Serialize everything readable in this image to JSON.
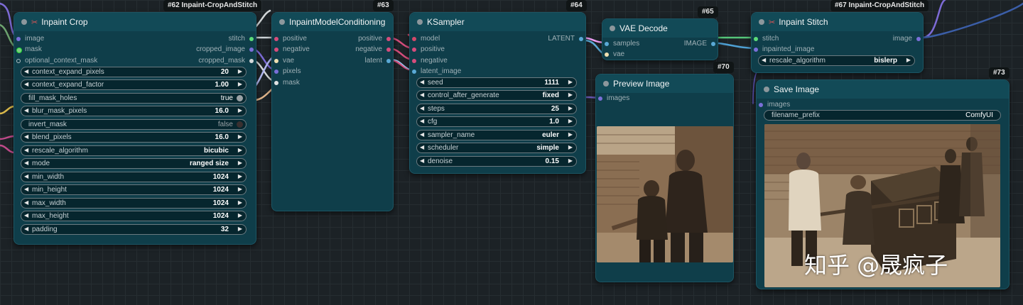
{
  "colors": {
    "model": "#b39ddb",
    "clip": "#ffd500",
    "conditioning": "#ff6e9c",
    "latent": "#ff9cf9",
    "vae": "#ff6e6e",
    "image": "#64b5f6",
    "mask": "#81c784",
    "stitch": "#5cdc78",
    "int": "#29b6f6"
  },
  "nodes": {
    "inpaint_crop": {
      "badge": "#62 Inpaint-CropAndStitch",
      "title": "Inpaint Crop",
      "title_icon": "scissors-icon",
      "inputs": [
        "image",
        "mask",
        "optional_context_mask"
      ],
      "outputs": [
        "stitch",
        "cropped_image",
        "cropped_mask"
      ],
      "widgets": [
        {
          "name": "context_expand_pixels",
          "value": "20"
        },
        {
          "name": "context_expand_factor",
          "value": "1.00"
        },
        {
          "name": "fill_mask_holes",
          "value": "true"
        },
        {
          "name": "blur_mask_pixels",
          "value": "16.0"
        },
        {
          "name": "invert_mask",
          "value": "false"
        },
        {
          "name": "blend_pixels",
          "value": "16.0"
        },
        {
          "name": "rescale_algorithm",
          "value": "bicubic"
        },
        {
          "name": "mode",
          "value": "ranged size"
        },
        {
          "name": "min_width",
          "value": "1024"
        },
        {
          "name": "min_height",
          "value": "1024"
        },
        {
          "name": "max_width",
          "value": "1024"
        },
        {
          "name": "max_height",
          "value": "1024"
        },
        {
          "name": "padding",
          "value": "32"
        }
      ]
    },
    "inpaint_model_conditioning": {
      "badge": "#63",
      "title": "InpaintModelConditioning",
      "inputs": [
        "positive",
        "negative",
        "vae",
        "pixels",
        "mask"
      ],
      "outputs": [
        "positive",
        "negative",
        "latent"
      ]
    },
    "ksampler": {
      "badge": "#64",
      "title": "KSampler",
      "inputs": [
        "model",
        "positive",
        "negative",
        "latent_image"
      ],
      "outputs": [
        "LATENT"
      ],
      "widgets": [
        {
          "name": "seed",
          "value": "1111"
        },
        {
          "name": "control_after_generate",
          "value": "fixed"
        },
        {
          "name": "steps",
          "value": "25"
        },
        {
          "name": "cfg",
          "value": "1.0"
        },
        {
          "name": "sampler_name",
          "value": "euler"
        },
        {
          "name": "scheduler",
          "value": "simple"
        },
        {
          "name": "denoise",
          "value": "0.15"
        }
      ]
    },
    "vae_decode": {
      "badge": "#65",
      "title": "VAE Decode",
      "inputs": [
        "samples",
        "vae"
      ],
      "outputs": [
        "IMAGE"
      ]
    },
    "preview_image": {
      "badge": "#70",
      "title": "Preview Image",
      "inputs": [
        "images"
      ]
    },
    "inpaint_stitch": {
      "badge": "#67 Inpaint-CropAndStitch",
      "title": "Inpaint Stitch",
      "title_icon": "scissors-icon",
      "inputs": [
        "stitch",
        "inpainted_image"
      ],
      "outputs": [
        "image"
      ],
      "widgets": [
        {
          "name": "rescale_algorithm",
          "value": "bislerp"
        }
      ]
    },
    "save_image": {
      "badge": "#73",
      "title": "Save Image",
      "inputs": [
        "images"
      ],
      "widgets": [
        {
          "name": "filename_prefix",
          "value": "ComfyUI"
        }
      ]
    }
  },
  "watermark": "知乎 @晟疯子"
}
